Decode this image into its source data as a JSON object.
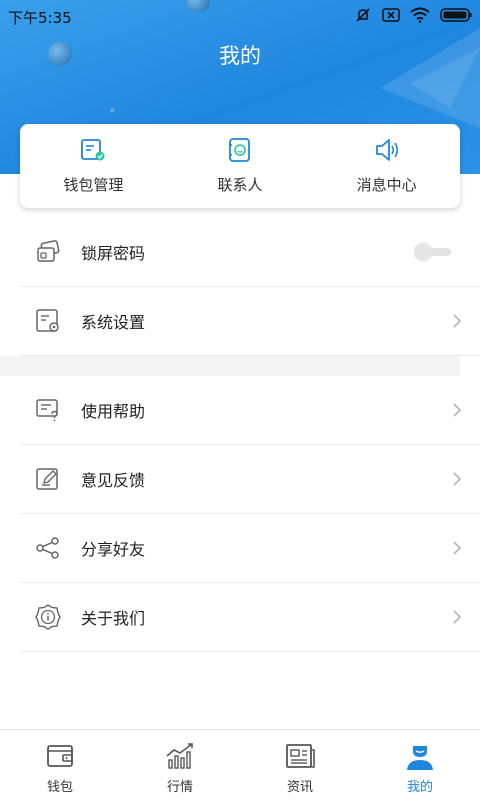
{
  "status_bar": {
    "time": "下午5:35"
  },
  "header": {
    "title": "我的"
  },
  "quick_actions": [
    {
      "label": "钱包管理",
      "icon": "wallet-manage-icon"
    },
    {
      "label": "联系人",
      "icon": "contacts-icon"
    },
    {
      "label": "消息中心",
      "icon": "speaker-icon"
    }
  ],
  "menu": {
    "lock_screen": {
      "label": "锁屏密码",
      "toggle_on": false
    },
    "settings": {
      "label": "系统设置"
    },
    "help": {
      "label": "使用帮助"
    },
    "feedback": {
      "label": "意见反馈"
    },
    "share": {
      "label": "分享好友"
    },
    "about": {
      "label": "关于我们"
    }
  },
  "tabs": [
    {
      "label": "钱包",
      "active": false
    },
    {
      "label": "行情",
      "active": false
    },
    {
      "label": "资讯",
      "active": false
    },
    {
      "label": "我的",
      "active": true
    }
  ],
  "colors": {
    "accent": "#1f86df",
    "header": "#2b93e6"
  }
}
